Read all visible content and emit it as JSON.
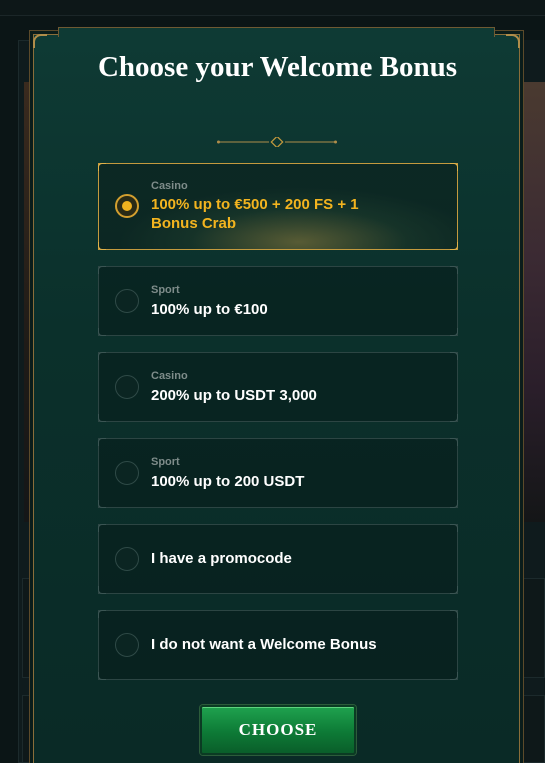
{
  "modal": {
    "title": "Choose your Welcome Bonus",
    "options": [
      {
        "category": "Casino",
        "label": "100% up to €500 + 200 FS + 1 Bonus Crab",
        "selected": true
      },
      {
        "category": "Sport",
        "label": "100% up to €100",
        "selected": false
      },
      {
        "category": "Casino",
        "label": "200% up to USDT 3,000",
        "selected": false
      },
      {
        "category": "Sport",
        "label": "100% up to 200 USDT",
        "selected": false
      },
      {
        "category": "",
        "label": "I have a promocode",
        "selected": false
      },
      {
        "category": "",
        "label": "I do not want a Welcome Bonus",
        "selected": false
      }
    ],
    "choose_label": "CHOOSE"
  },
  "colors": {
    "accent_gold": "#f3b41f",
    "modal_bg": "#0e3a34",
    "button_green": "#12873d"
  },
  "icons": {
    "divider": "diamond-divider-icon",
    "radio_selected": "radio-selected-icon",
    "radio_unselected": "radio-unselected-icon"
  }
}
